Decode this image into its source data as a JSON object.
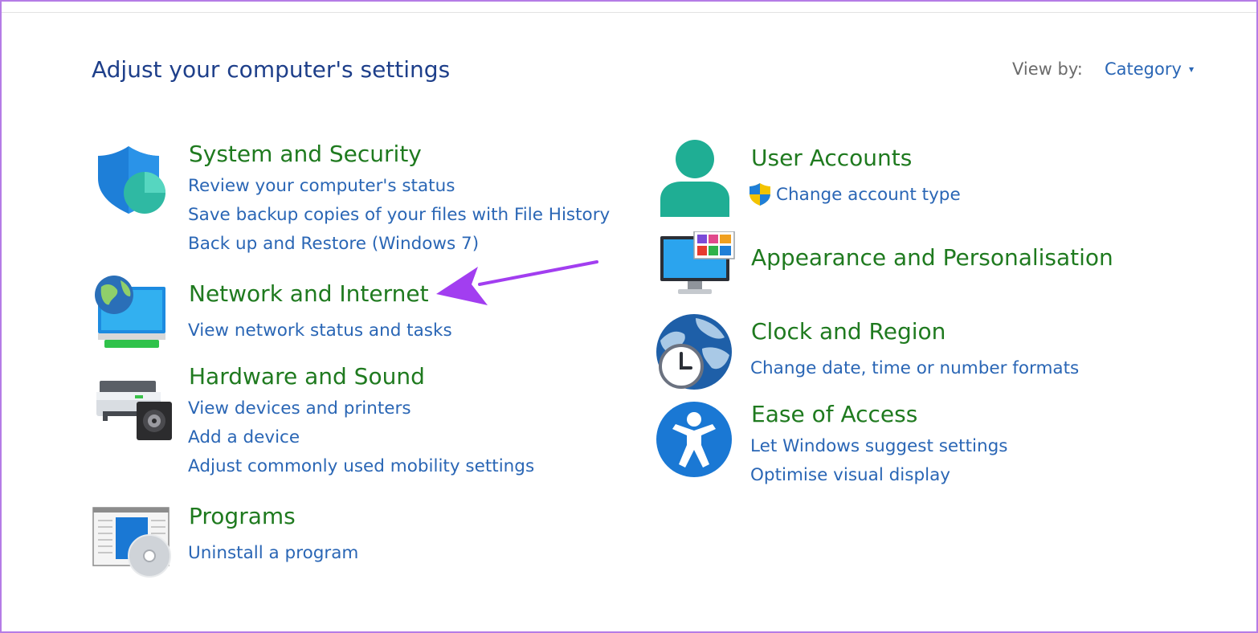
{
  "header": {
    "title": "Adjust your computer's settings",
    "view_by_label": "View by:",
    "view_by_value": "Category"
  },
  "left_categories": [
    {
      "title": "System and Security",
      "icon": "shield-icon",
      "links": [
        "Review your computer's status",
        "Save backup copies of your files with File History",
        "Back up and Restore (Windows 7)"
      ]
    },
    {
      "title": "Network and Internet",
      "icon": "network-globe-icon",
      "links": [
        "View network status and tasks"
      ]
    },
    {
      "title": "Hardware and Sound",
      "icon": "printer-speaker-icon",
      "links": [
        "View devices and printers",
        "Add a device",
        "Adjust commonly used mobility settings"
      ]
    },
    {
      "title": "Programs",
      "icon": "programs-disc-icon",
      "links": [
        "Uninstall a program"
      ]
    }
  ],
  "right_categories": [
    {
      "title": "User Accounts",
      "icon": "user-icon",
      "links": [
        "Change account type"
      ],
      "link_icon": "uac-shield-icon"
    },
    {
      "title": "Appearance and Personalisation",
      "icon": "monitor-palette-icon",
      "links": []
    },
    {
      "title": "Clock and Region",
      "icon": "globe-clock-icon",
      "links": [
        "Change date, time or number formats"
      ]
    },
    {
      "title": "Ease of Access",
      "icon": "accessibility-icon",
      "links": [
        "Let Windows suggest settings",
        "Optimise visual display"
      ]
    }
  ],
  "annotation": {
    "icon": "purple-arrow-icon",
    "color": "#a23ef0"
  }
}
